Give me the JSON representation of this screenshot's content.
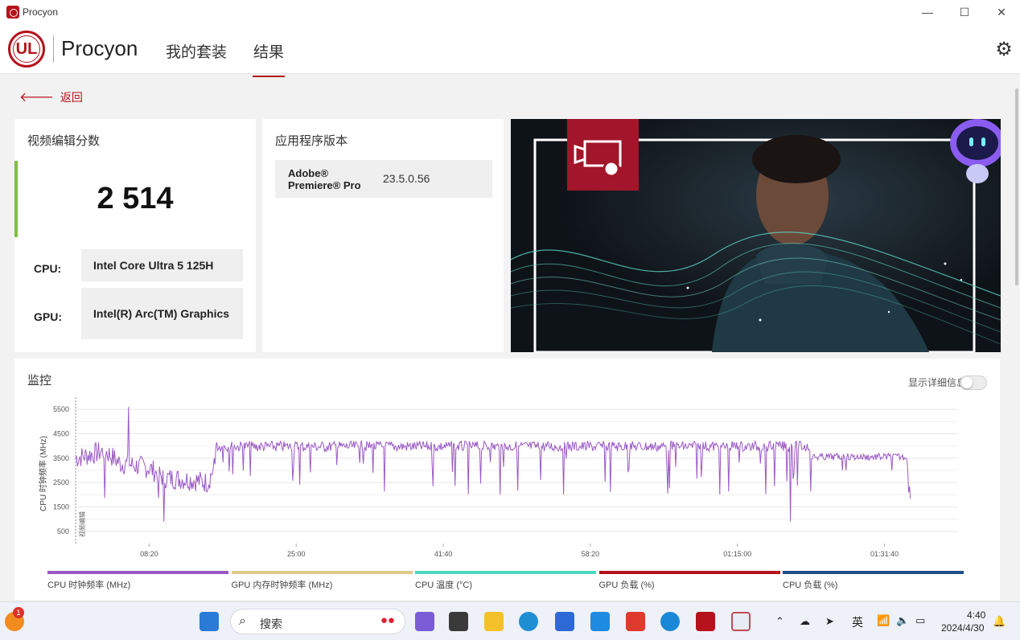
{
  "window": {
    "title": "Procyon",
    "controls": [
      "—",
      "☐",
      "✕"
    ]
  },
  "header": {
    "logo_text": "UL",
    "brand": "Procyon",
    "tabs": [
      {
        "label": "我的套装",
        "active": false
      },
      {
        "label": "结果",
        "active": true
      }
    ],
    "settings_icon": "gear-icon"
  },
  "back": {
    "label": "返回"
  },
  "score_card": {
    "title": "视频编辑分数",
    "score": "2 514",
    "cpu_label": "CPU:",
    "cpu_value": "Intel Core Ultra 5 125H",
    "gpu_label": "GPU:",
    "gpu_value": "Intel(R) Arc(TM) Graphics"
  },
  "version_card": {
    "title": "应用程序版本",
    "app_name_line1": "Adobe®",
    "app_name_line2": "Premiere® Pro",
    "version": "23.5.0.56"
  },
  "monitor": {
    "title": "监控",
    "toggle_label": "显示详细信息",
    "toggle_on": false,
    "legend": [
      {
        "label": "CPU 时钟频率 (MHz)",
        "color": "#9b59c6"
      },
      {
        "label": "GPU 内存时钟频率 (MHz)",
        "color": "#e2c98a"
      },
      {
        "label": "CPU 温度 (°C)",
        "color": "#4dd9bc"
      },
      {
        "label": "GPU 负载 (%)",
        "color": "#b5121b"
      },
      {
        "label": "CPU 负载 (%)",
        "color": "#1f4f8a"
      }
    ]
  },
  "chart_data": {
    "type": "line",
    "ylabel": "CPU 时钟频率 (MHz)",
    "marker_label": "视频编辑",
    "y_ticks": [
      500,
      1500,
      2500,
      3500,
      4500,
      5500
    ],
    "ylim": [
      0,
      6000
    ],
    "x_ticks": [
      "08:20",
      "25:00",
      "41:40",
      "58:20",
      "01:15:00",
      "01:31:40"
    ],
    "xlim_seconds": [
      0,
      6000
    ],
    "x_tick_seconds": [
      500,
      1500,
      2500,
      3500,
      4500,
      5500
    ],
    "grid": true,
    "series": [
      {
        "name": "CPU 时钟频率 (MHz)",
        "color": "#9b59c6",
        "approx_profile": [
          {
            "t": 0,
            "v": 3500
          },
          {
            "t": 200,
            "v": 3800
          },
          {
            "t": 300,
            "v": 3300
          },
          {
            "t": 500,
            "v": 3100
          },
          {
            "t": 600,
            "v": 2700
          },
          {
            "t": 800,
            "v": 2600
          },
          {
            "t": 900,
            "v": 2500
          },
          {
            "t": 1000,
            "v": 4000
          },
          {
            "t": 2000,
            "v": 3900
          },
          {
            "t": 3000,
            "v": 3900
          },
          {
            "t": 4000,
            "v": 3900
          },
          {
            "t": 4800,
            "v": 3900
          },
          {
            "t": 5000,
            "v": 3600
          },
          {
            "t": 5600,
            "v": 3600
          },
          {
            "t": 5680,
            "v": 2000
          }
        ]
      }
    ]
  },
  "taskbar": {
    "search_placeholder": "搜索",
    "badge_count": "1",
    "ime": "英",
    "time": "4:40",
    "date": "2024/4/30"
  }
}
